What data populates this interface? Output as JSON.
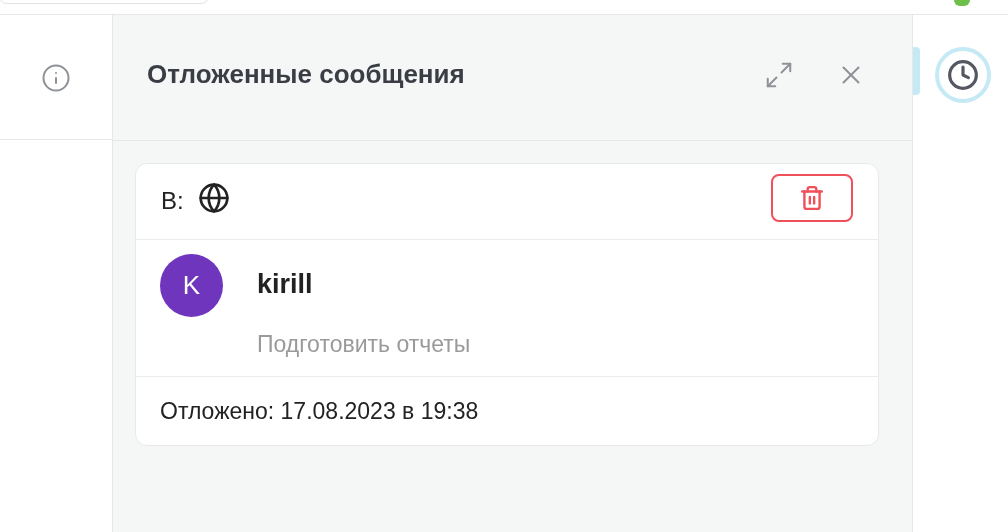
{
  "panel": {
    "title": "Отложенные сообщения"
  },
  "messages": [
    {
      "to_label": "В:",
      "author": "kirill",
      "avatar_letter": "K",
      "text": "Подготовить отчеты",
      "scheduled": "Отложено: 17.08.2023 в 19:38"
    }
  ]
}
